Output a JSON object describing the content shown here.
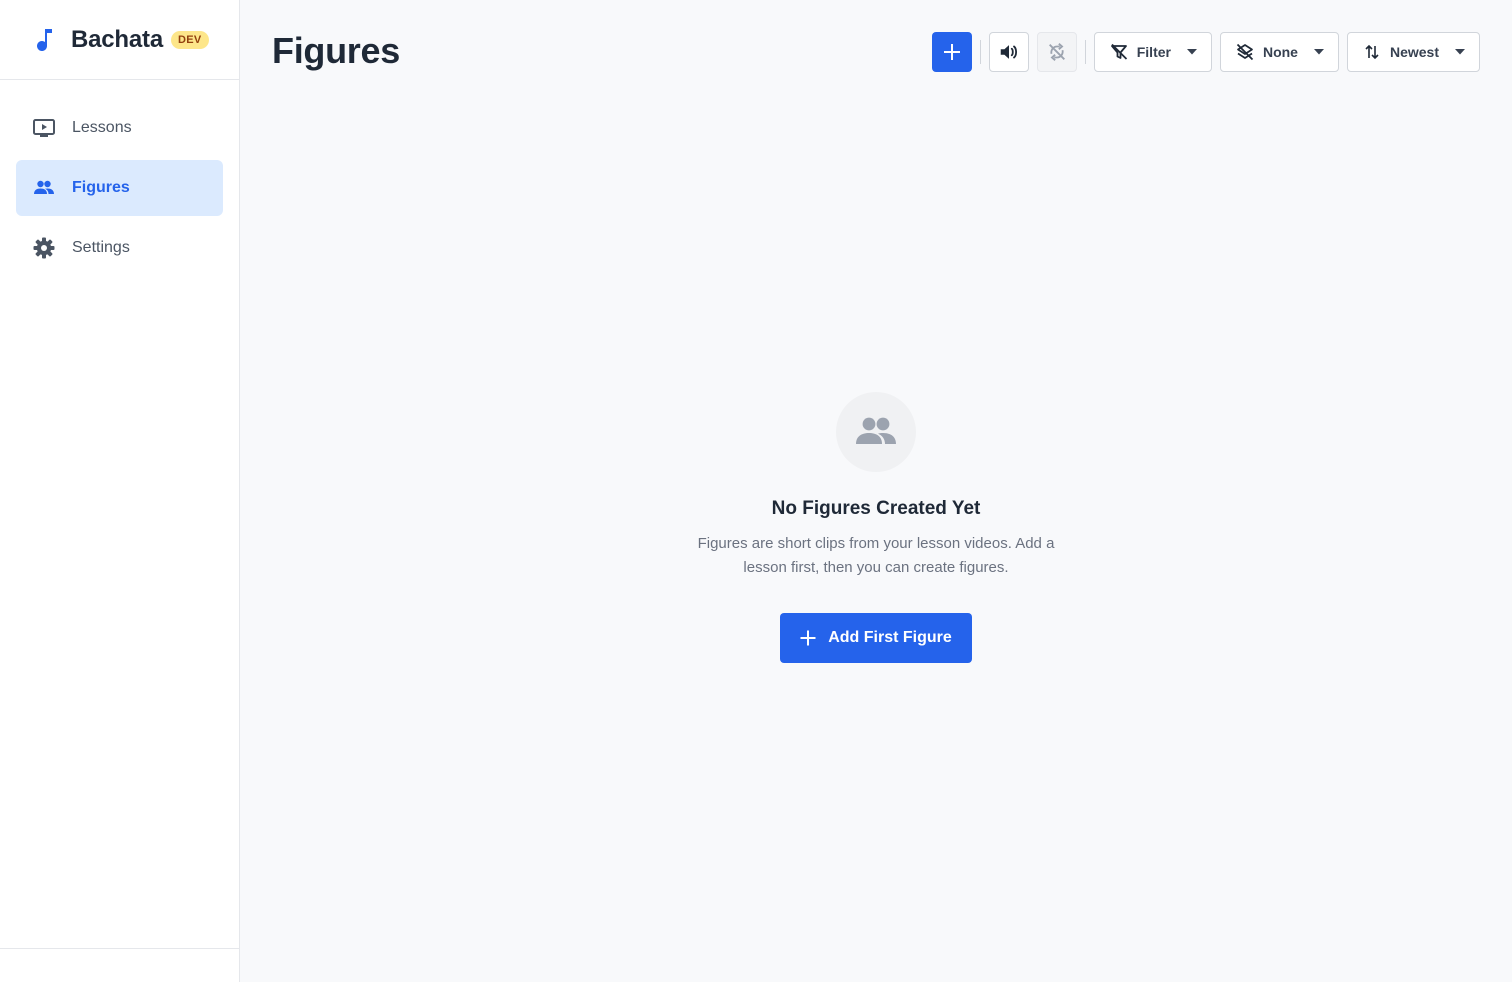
{
  "sidebar": {
    "brand": {
      "name": "Bachata",
      "badge": "DEV",
      "icon": "music-note-icon"
    },
    "items": [
      {
        "label": "Lessons",
        "icon": "video-player-icon",
        "active": false
      },
      {
        "label": "Figures",
        "icon": "people-icon",
        "active": true
      },
      {
        "label": "Settings",
        "icon": "gear-icon",
        "active": false
      }
    ]
  },
  "header": {
    "title": "Figures",
    "toolbar": {
      "add_icon": "plus-icon",
      "sound_icon": "volume-icon",
      "sync_icon": "sync-disabled-icon",
      "filter": {
        "label": "Filter",
        "icon": "filter-off-icon"
      },
      "group": {
        "label": "None",
        "icon": "layers-off-icon"
      },
      "sort": {
        "label": "Newest",
        "icon": "sort-icon"
      }
    }
  },
  "empty_state": {
    "icon": "people-icon",
    "title": "No Figures Created Yet",
    "description": "Figures are short clips from your lesson videos. Add a lesson first, then you can create figures.",
    "button_label": "Add First Figure"
  },
  "colors": {
    "accent": "#2563eb",
    "active_bg": "#dbeafe",
    "badge_bg": "#fde68a",
    "background": "#f8f9fb"
  }
}
